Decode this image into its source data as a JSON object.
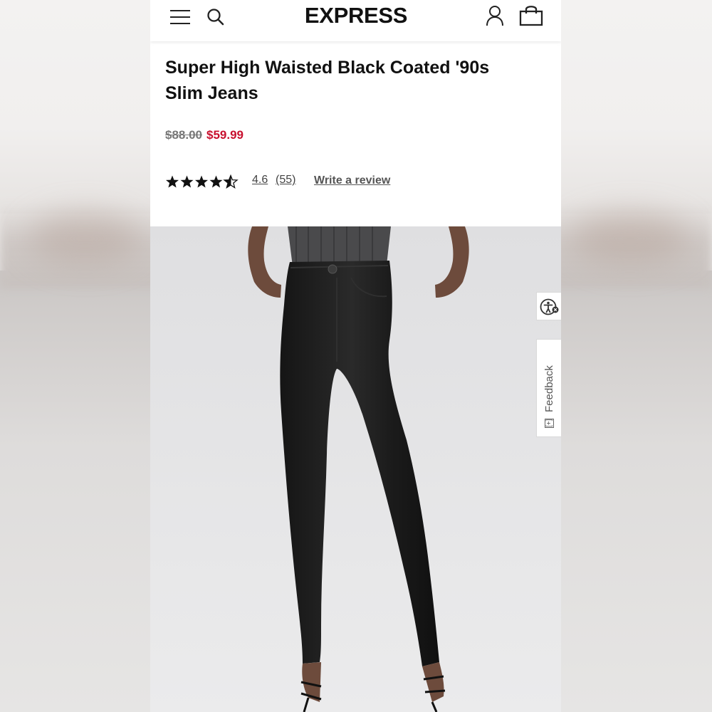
{
  "header": {
    "logo": "EXPRESS",
    "icons": [
      "hamburger-menu-icon",
      "search-icon",
      "account-icon",
      "shopping-bag-icon"
    ]
  },
  "product": {
    "title": "Super High Waisted Black Coated '90s Slim Jeans",
    "price_original": "$88.00",
    "price_sale": "$59.99",
    "rating_value": "4.6",
    "rating_count": "(55)",
    "rating_stars": 4.6,
    "write_review": "Write a review"
  },
  "side_widgets": {
    "feedback_label": "Feedback",
    "feedback_icon": "[+]"
  },
  "colors": {
    "sale_price": "#c8102e",
    "text": "#111111",
    "muted": "#777777"
  }
}
